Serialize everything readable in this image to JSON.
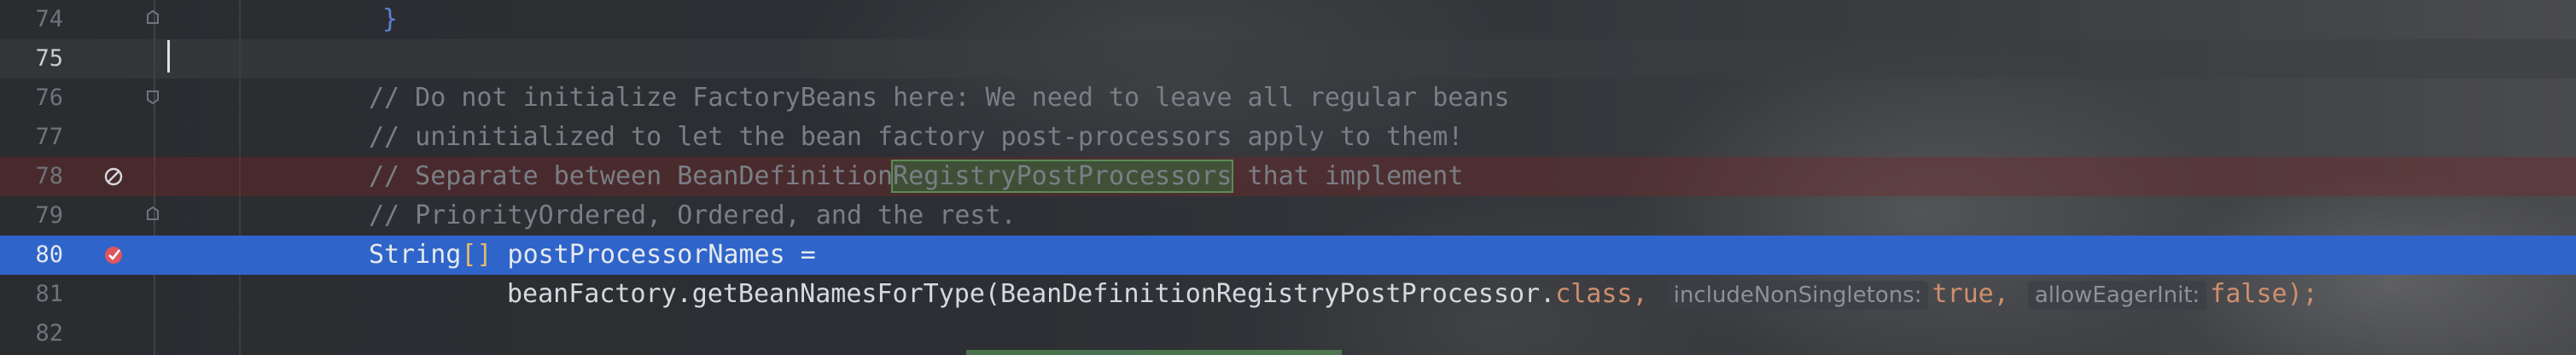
{
  "editor": {
    "lines": [
      {
        "number": "74",
        "code": "}"
      },
      {
        "number": "75",
        "code": ""
      },
      {
        "number": "76",
        "code": "// Do not initialize FactoryBeans here: We need to leave all regular beans"
      },
      {
        "number": "77",
        "code": "// uninitialized to let the bean factory post-processors apply to them!"
      },
      {
        "number": "78",
        "code_pre": "// Separate between BeanDefinition",
        "code_match": "RegistryPostProcessors",
        "code_post": " that implement"
      },
      {
        "number": "79",
        "code": "// PriorityOrdered, Ordered, and the rest."
      },
      {
        "number": "80",
        "code_type": "String",
        "code_brackets": "[]",
        "code_var": " postProcessorNames",
        "code_eq": " ="
      },
      {
        "number": "81",
        "code_call": "beanFactory.getBeanNamesForType(BeanDefinitionRegistryPostProcessor.",
        "code_class_kw": "class",
        "code_comma1": ",",
        "hint1": "includeNonSingletons:",
        "val1": "true",
        "code_comma2": ",",
        "hint2": "allowEagerInit:",
        "val2": "false",
        "code_end": ");"
      },
      {
        "number": "82",
        "code": ""
      }
    ]
  },
  "colors": {
    "execution_line": "#2f65ca",
    "disabled_breakpoint_line": "#7a2a2a",
    "keyword": "#cf8e6d",
    "comment": "#7a7e85"
  },
  "icons": {
    "line78": "disabled-breakpoint-icon",
    "line80": "breakpoint-checked-icon"
  }
}
